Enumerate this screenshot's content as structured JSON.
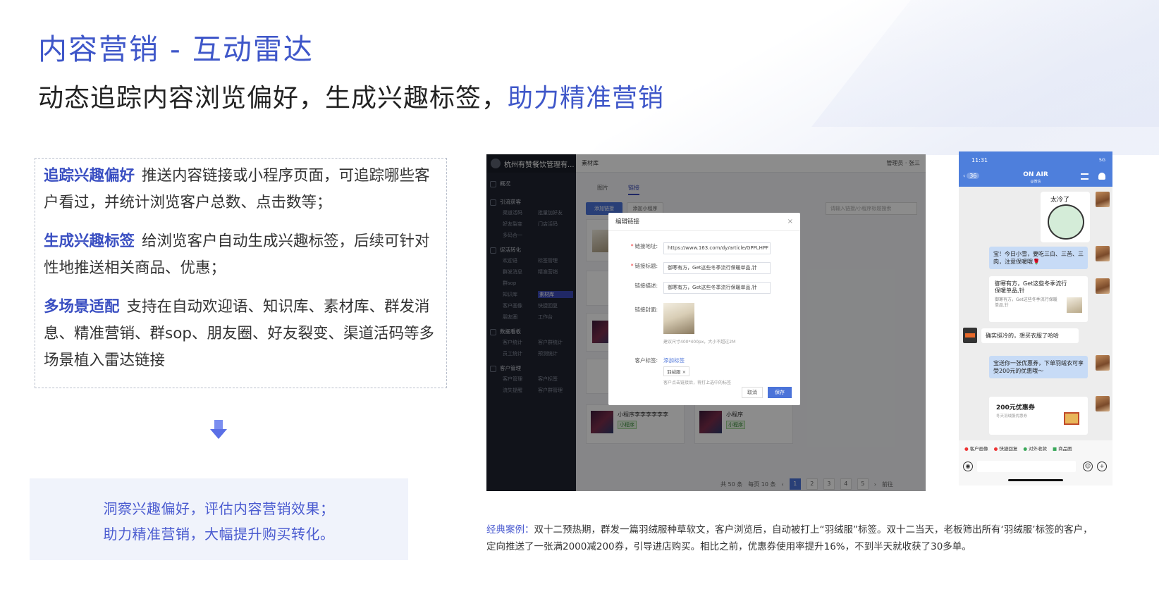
{
  "header": {
    "title": "内容营销 - 互动雷达",
    "subtitle_main": "动态追踪内容浏览偏好，生成兴趣标签，",
    "subtitle_highlight": "助力精准营销"
  },
  "features": [
    {
      "title": "追踪兴趣偏好",
      "text": "推送内容链接或小程序页面，可追踪哪些客户看过，并统计浏览客户总数、点击数等；"
    },
    {
      "title": "生成兴趣标签",
      "text": "给浏览客户自动生成兴趣标签，后续可针对性地推送相关商品、优惠；"
    },
    {
      "title": "多场景适配",
      "text": "支持在自动欢迎语、知识库、素材库、群发消息、精准营销、群sop、朋友圈、好友裂变、渠道活码等多场景植入雷达链接"
    }
  ],
  "summary": {
    "line1": "洞察兴趣偏好，评估内容营销效果；",
    "line2": "助力精准营销，大幅提升购买转化。"
  },
  "admin": {
    "brand": "杭州有赞餐饮管理有...",
    "topbar_title": "素材库",
    "topbar_right": "管理员 · 张三",
    "menu": [
      {
        "group": "概况",
        "items": []
      },
      {
        "group": "引流获客",
        "items": [
          "渠道活码",
          "批量加好友",
          "好友裂变",
          "门店活码",
          "多码合一"
        ]
      },
      {
        "group": "促活转化",
        "items": [
          "欢迎语",
          "标签管理",
          "群发消息",
          "精准营销",
          "群sop",
          "",
          "知识库",
          "素材库",
          "客户画像",
          "快捷回复",
          "朋友圈",
          "工作台"
        ]
      },
      {
        "group": "数据看板",
        "items": [
          "客户统计",
          "客户群统计",
          "员工统计",
          "预测统计"
        ]
      },
      {
        "group": "客户管理",
        "items": [
          "客户管理",
          "客户标签",
          "流失提醒",
          "客户群管理"
        ]
      }
    ],
    "tabs": [
      "图片",
      "链接"
    ],
    "add_button": "添加链接",
    "add_button2": "添加小程序",
    "search_placeholder": "请输入链接/小程序标题搜索",
    "cards": [
      {
        "title": "小程序李李李李李李",
        "tag": "小程序"
      },
      {
        "title": "小程序",
        "tag": "小程序"
      }
    ],
    "pager": {
      "total": "共 50 条",
      "per_page": "每页 10 条",
      "pages": [
        "1",
        "2",
        "3",
        "4",
        "5"
      ],
      "current": "1",
      "goto": "前往"
    },
    "dialog": {
      "title": "编辑链接",
      "close": "×",
      "link_label": "链接地址:",
      "link_value": "https://www.163.com/dy/article/GPFLHPF",
      "title_label": "链接标题:",
      "title_value": "御寒有方，Get这些冬季流行保暖单品,针",
      "desc_label": "链接描述:",
      "desc_value": "御寒有方，Get这些冬季流行保暖单品,针",
      "cover_label": "链接封面:",
      "cover_hint": "建议尺寸400*400px，大小不超过2M",
      "tag_label": "客户标签:",
      "tag_link": "添加标签",
      "tag_value": "羽绒服 ×",
      "tag_hint": "客户点击链接后，将打上选中的标签",
      "cancel": "取消",
      "save": "保存"
    }
  },
  "phone": {
    "time": "11:31",
    "status": "5G",
    "back_count": "36",
    "title": "ON AIR",
    "subtitle": "@微信",
    "sticker_text": "太冷了",
    "msg1": "宝！今日小雪，要吃三白、三苦、三肉，注意保暖哦🌹",
    "link_title": "御寒有方，Get这些冬季流行保暖单品,针",
    "link_desc": "御寒有方，Get这些冬季流行保暖单品,针",
    "msg2": "确实挺冷的，想买衣服了哈哈",
    "msg3": "宝送你一张优惠券，下单羽绒衣可享受200元的优惠哦～",
    "coupon_title": "200元优惠券",
    "coupon_desc": "冬天羽绒服优惠券",
    "tools": [
      "客户画像",
      "快捷回复",
      "对外收款",
      "商品图"
    ]
  },
  "case": {
    "label": "经典案例：",
    "text": "双十二预热期，群发一篇羽绒服种草软文，客户浏览后，自动被打上“羽绒服”标签。双十二当天，老板筛出所有‘羽绒服’标签的客户，定向推送了一张满2000减200券，引导进店购买。相比之前，优惠券使用率提升16%，不到半天就收获了30多单。"
  }
}
